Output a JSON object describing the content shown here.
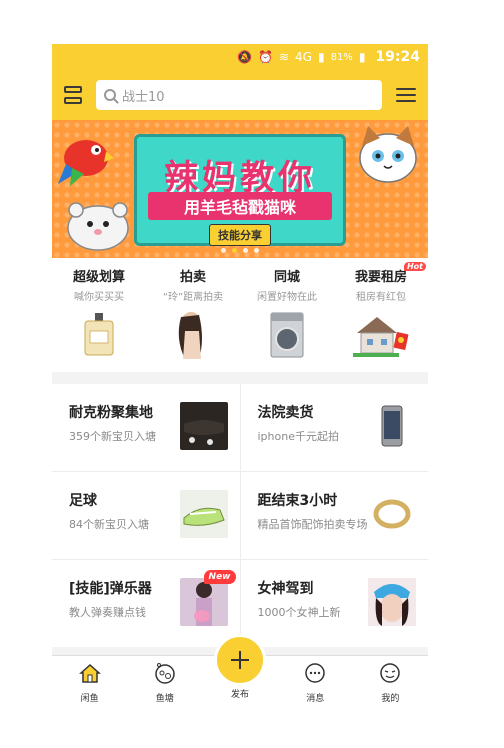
{
  "status_bar": {
    "network": "4G",
    "battery": "81%",
    "time": "19:24"
  },
  "header": {
    "search_placeholder": "战士10"
  },
  "banner": {
    "title": "辣妈教你",
    "subtitle": "用羊毛毡戳猫咪",
    "tag": "技能分享",
    "dots": 4,
    "active_dot": 1
  },
  "features": [
    {
      "title": "超级划算",
      "subtitle": "喊你买买买",
      "badge": ""
    },
    {
      "title": "拍卖",
      "subtitle": "“玲”距离拍卖",
      "badge": ""
    },
    {
      "title": "同城",
      "subtitle": "闲置好物在此",
      "badge": ""
    },
    {
      "title": "我要租房",
      "subtitle": "租房有红包",
      "badge": "Hot"
    }
  ],
  "cards": [
    {
      "title": "耐克粉聚集地",
      "subtitle": "359个新宝贝入塘",
      "badge": ""
    },
    {
      "title": "法院卖货",
      "subtitle": "iphone千元起拍",
      "badge": ""
    },
    {
      "title": "足球",
      "subtitle": "84个新宝贝入塘",
      "badge": ""
    },
    {
      "title": "距结束3小时",
      "subtitle": "精品首饰配饰拍卖专场",
      "badge": ""
    },
    {
      "title": "[技能]弹乐器",
      "subtitle": "教人弹奏赚点钱",
      "badge": "New"
    },
    {
      "title": "女神驾到",
      "subtitle": "1000个女神上新",
      "badge": ""
    }
  ],
  "tabbar": [
    {
      "label": "闲鱼",
      "icon": "home-icon",
      "active": true
    },
    {
      "label": "鱼塘",
      "icon": "fishpond-icon",
      "active": false
    },
    {
      "label": "发布",
      "icon": "plus-icon",
      "active": false
    },
    {
      "label": "消息",
      "icon": "message-icon",
      "active": false
    },
    {
      "label": "我的",
      "icon": "profile-icon",
      "active": false
    }
  ],
  "colors": {
    "brand_yellow": "#f9cf31",
    "hot_red": "#ff4a4a"
  }
}
